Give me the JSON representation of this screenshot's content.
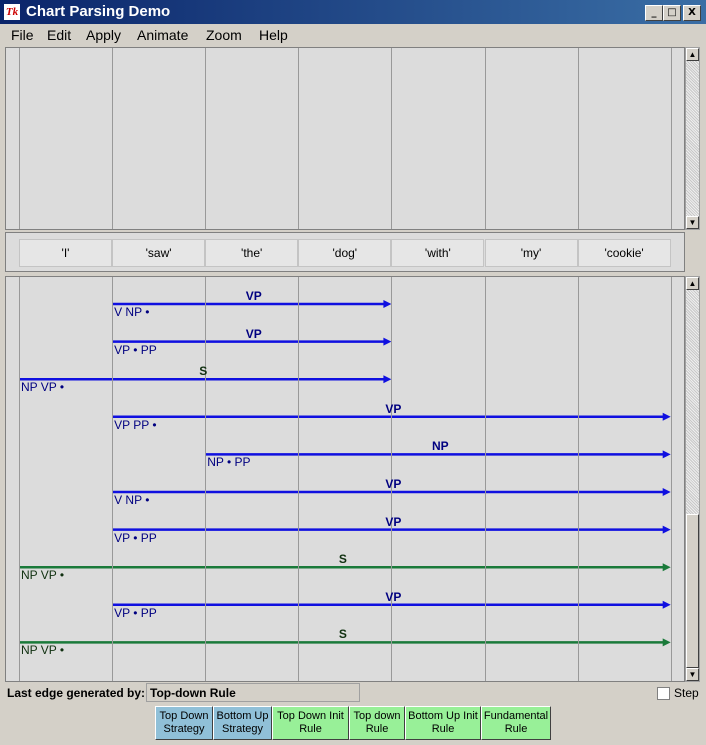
{
  "window": {
    "title": "Chart Parsing Demo",
    "tk_icon": "Tk",
    "controls": [
      "_",
      "□",
      "X"
    ]
  },
  "menu": [
    "File",
    "Edit",
    "Apply",
    "Animate",
    "Zoom",
    "Help"
  ],
  "words": [
    "'I'",
    "'saw'",
    "'the'",
    "'dog'",
    "'with'",
    "'my'",
    "'cookie'"
  ],
  "edges": [
    {
      "label": "VP",
      "rhs": "V NP",
      "dot": "end",
      "start": 1,
      "end": 4,
      "color": "#1010e0"
    },
    {
      "label": "VP",
      "rhs_before": "VP",
      "rhs_after": "PP",
      "dot": "mid",
      "start": 1,
      "end": 4,
      "color": "#1010e0"
    },
    {
      "label": "S",
      "rhs": "NP VP",
      "dot": "end",
      "start": 0,
      "end": 4,
      "color": "#1010e0"
    },
    {
      "label": "VP",
      "rhs": "VP PP",
      "dot": "end",
      "start": 1,
      "end": 7,
      "color": "#1010e0"
    },
    {
      "label": "NP",
      "rhs_before": "NP",
      "rhs_after": "PP",
      "dot": "mid",
      "start": 2,
      "end": 7,
      "color": "#1010e0"
    },
    {
      "label": "VP",
      "rhs": "V NP",
      "dot": "end",
      "start": 1,
      "end": 7,
      "color": "#1010e0"
    },
    {
      "label": "VP",
      "rhs_before": "VP",
      "rhs_after": "PP",
      "dot": "mid",
      "start": 1,
      "end": 7,
      "color": "#1010e0"
    },
    {
      "label": "S",
      "rhs": "NP VP",
      "dot": "end",
      "start": 0,
      "end": 7,
      "color": "#1a7a3a"
    },
    {
      "label": "VP",
      "rhs_before": "VP",
      "rhs_after": "PP",
      "dot": "mid",
      "start": 1,
      "end": 7,
      "color": "#1010e0"
    },
    {
      "label": "S",
      "rhs": "NP VP",
      "dot": "end",
      "start": 0,
      "end": 7,
      "color": "#1a7a3a"
    }
  ],
  "status": {
    "label": "Last edge generated by:",
    "value": "Top-down Rule",
    "step_label": "Step"
  },
  "buttons": [
    {
      "line1": "Top Down",
      "line2": "Strategy",
      "color": "#90c0d8"
    },
    {
      "line1": "Bottom Up",
      "line2": "Strategy",
      "color": "#90c0d8"
    },
    {
      "line1": "Top Down Init",
      "line2": "Rule",
      "color": "#98f098"
    },
    {
      "line1": "Top down",
      "line2": "Rule",
      "color": "#98f098"
    },
    {
      "line1": "Bottom Up Init",
      "line2": "Rule",
      "color": "#98f098"
    },
    {
      "line1": "Fundamental",
      "line2": "Rule",
      "color": "#98f098"
    }
  ]
}
